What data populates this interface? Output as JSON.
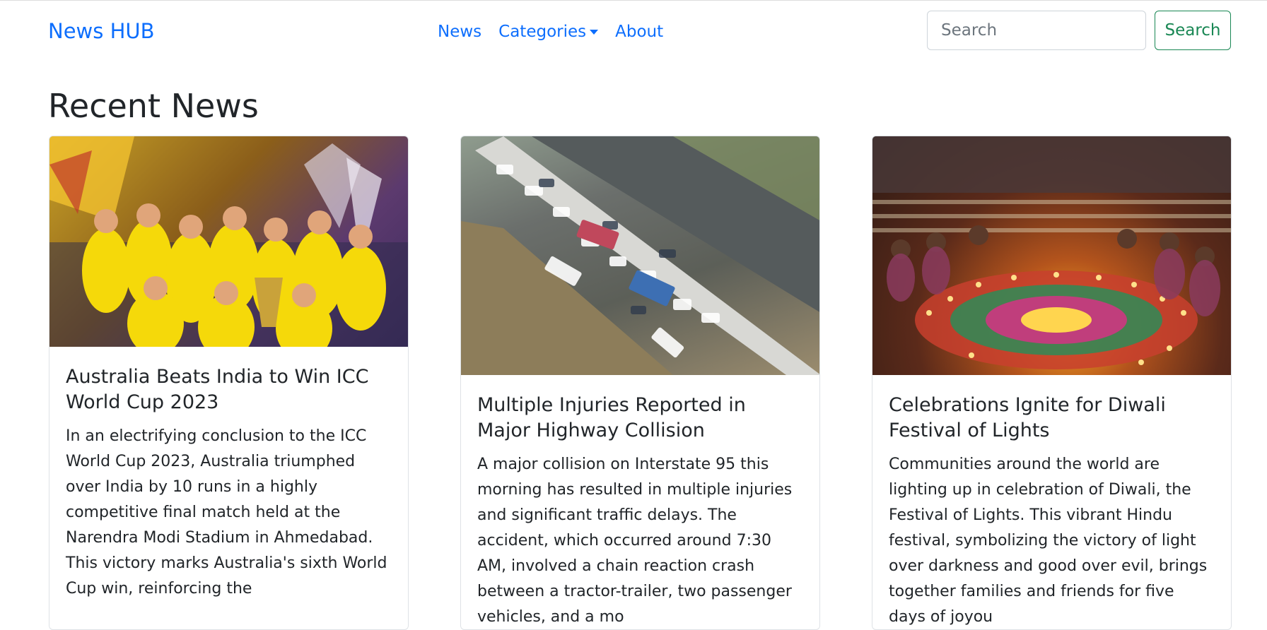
{
  "navbar": {
    "brand": "News HUB",
    "links": [
      {
        "label": "News"
      },
      {
        "label": "Categories"
      },
      {
        "label": "About"
      }
    ],
    "search": {
      "placeholder": "Search",
      "button_label": "Search"
    }
  },
  "main": {
    "section_title": "Recent News",
    "cards": [
      {
        "title": "Australia Beats India to Win ICC World Cup 2023",
        "text": "In an electrifying conclusion to the ICC World Cup 2023, Australia triumphed over India by 10 runs in a highly competitive final match held at the Narendra Modi Stadium in Ahmedabad. This victory marks Australia's sixth World Cup win, reinforcing the"
      },
      {
        "title": "Multiple Injuries Reported in Major Highway Collision",
        "text": "A major collision on Interstate 95 this morning has resulted in multiple injuries and significant traffic delays. The accident, which occurred around 7:30 AM, involved a chain reaction crash between a tractor-trailer, two passenger vehicles, and a mo"
      },
      {
        "title": "Celebrations Ignite for Diwali Festival of Lights",
        "text": "Communities around the world are lighting up in celebration of Diwali, the Festival of Lights. This vibrant Hindu festival, symbolizing the victory of light over darkness and good over evil, brings together families and friends for five days of joyou"
      }
    ]
  },
  "colors": {
    "link": "#0d6efd",
    "success": "#198754"
  }
}
